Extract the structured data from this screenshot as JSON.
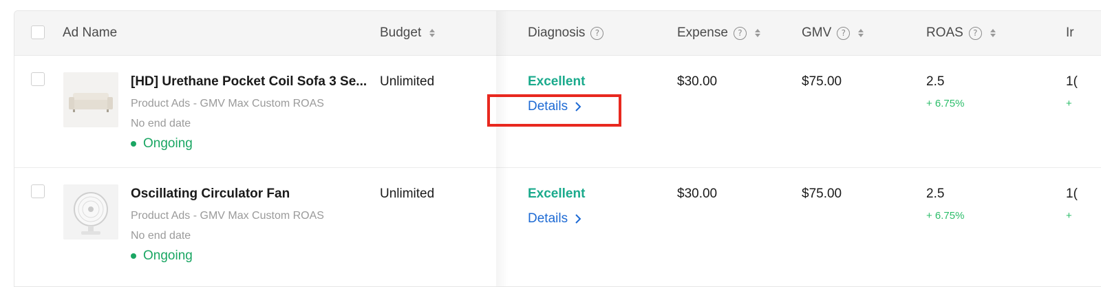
{
  "header": {
    "ad_name": "Ad Name",
    "budget": "Budget",
    "diagnosis": "Diagnosis",
    "expense": "Expense",
    "gmv": "GMV",
    "roas": "ROAS",
    "next_col_partial": "Ir",
    "help_glyph": "?"
  },
  "rows": [
    {
      "ad_name": "[HD] Urethane Pocket Coil Sofa 3 Se...",
      "ad_type": "Product Ads - GMV Max Custom ROAS",
      "end_date": "No end date",
      "status": "Ongoing",
      "budget": "Unlimited",
      "diagnosis": "Excellent",
      "details_label": "Details",
      "expense": "$30.00",
      "gmv": "$75.00",
      "roas": "2.5",
      "roas_change": "+ 6.75%",
      "next_value_partial": "1(",
      "next_change_partial": "+",
      "thumb_icon": "sofa-icon"
    },
    {
      "ad_name": "Oscillating Circulator Fan",
      "ad_type": "Product Ads - GMV Max Custom ROAS",
      "end_date": "No end date",
      "status": "Ongoing",
      "budget": "Unlimited",
      "diagnosis": "Excellent",
      "details_label": "Details",
      "expense": "$30.00",
      "gmv": "$75.00",
      "roas": "2.5",
      "roas_change": "+ 6.75%",
      "next_value_partial": "1(",
      "next_change_partial": "+",
      "thumb_icon": "fan-icon"
    }
  ],
  "colors": {
    "status_green": "#1aa663",
    "diagnosis_teal": "#1aaa8c",
    "link_blue": "#1d6ad4",
    "change_green": "#2cbd6a",
    "highlight_red": "#e8281f"
  }
}
